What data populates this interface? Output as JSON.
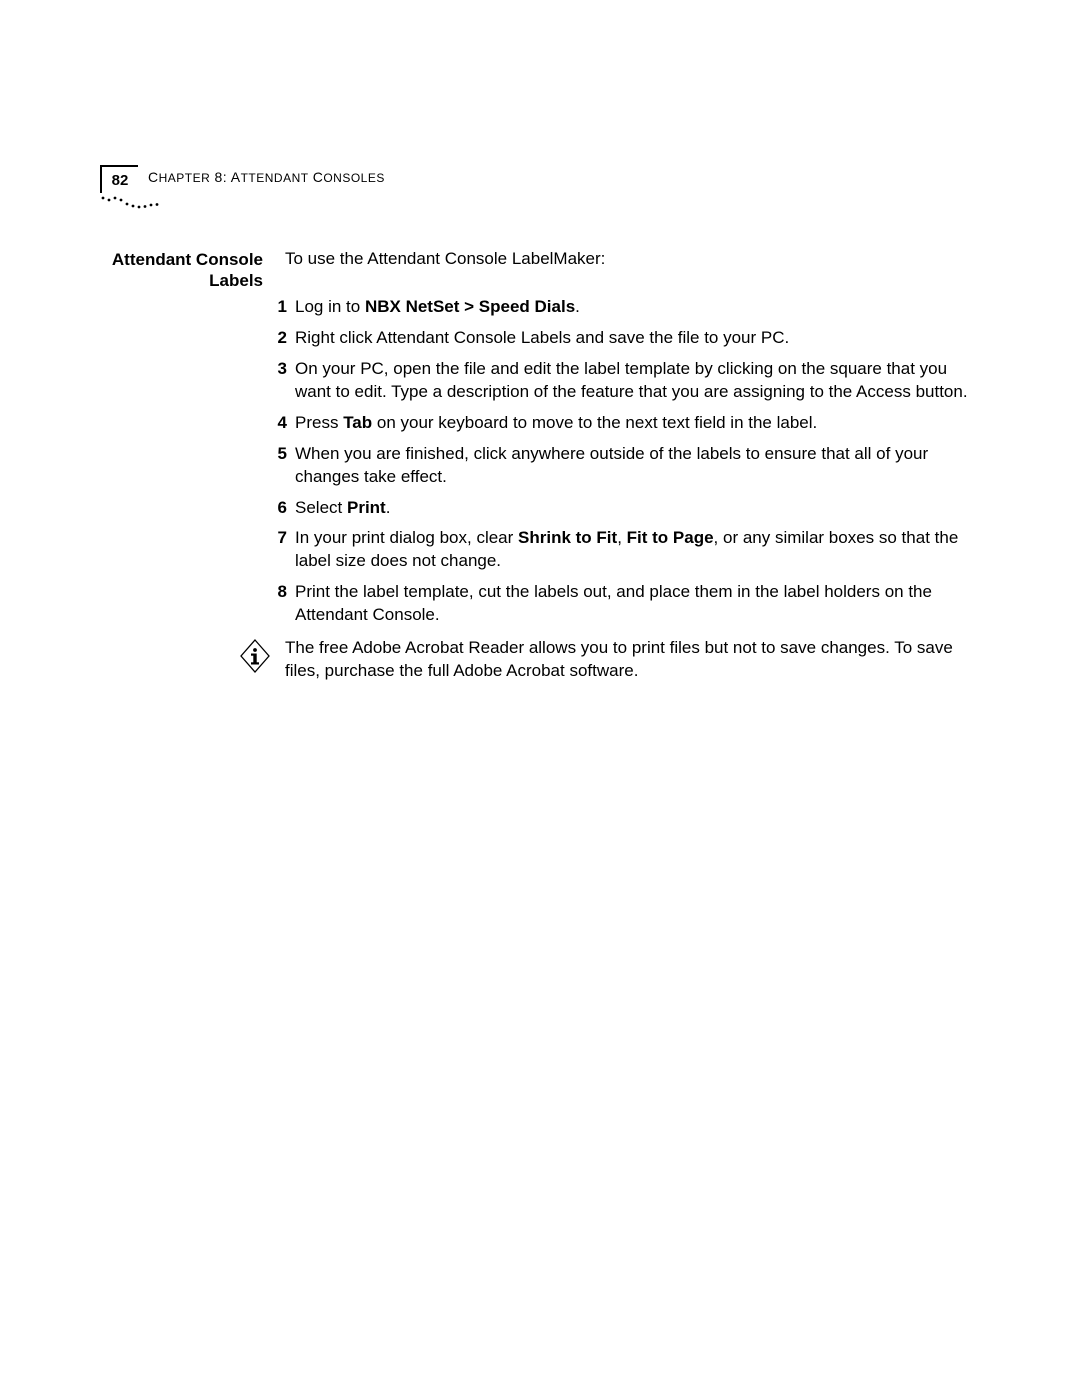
{
  "header": {
    "page_number": "82",
    "chapter_label": "Chapter 8: Attendant Consoles"
  },
  "section": {
    "title_line1": "Attendant Console",
    "title_line2": "Labels",
    "intro": "To use the Attendant Console LabelMaker:"
  },
  "steps": [
    {
      "num": "1",
      "pre": "Log in to ",
      "bold": "NBX NetSet > Speed Dials",
      "post": "."
    },
    {
      "num": "2",
      "text": "Right click Attendant Console Labels and save the file to your PC."
    },
    {
      "num": "3",
      "text": "On your PC, open the file and edit the label template by clicking on the square that you want to edit. Type a description of the feature that you are assigning to the Access button."
    },
    {
      "num": "4",
      "pre": "Press ",
      "bold": "Tab",
      "post": " on your keyboard to move to the next text field in the label."
    },
    {
      "num": "5",
      "text": "When you are finished, click anywhere outside of the labels to ensure that all of your changes take effect."
    },
    {
      "num": "6",
      "pre": "Select ",
      "bold": "Print",
      "post": "."
    },
    {
      "num": "7",
      "pre": "In your print dialog box, clear ",
      "bold": "Shrink to Fit",
      "mid": ", ",
      "bold2": "Fit to Page",
      "post": ", or any similar boxes so that the label size does not change."
    },
    {
      "num": "8",
      "text": "Print the label template, cut the labels out, and place them in the label holders on the Attendant Console."
    }
  ],
  "note": {
    "text": "The free Adobe Acrobat Reader allows you to print files but not to save changes. To save files, purchase the full Adobe Acrobat software."
  }
}
